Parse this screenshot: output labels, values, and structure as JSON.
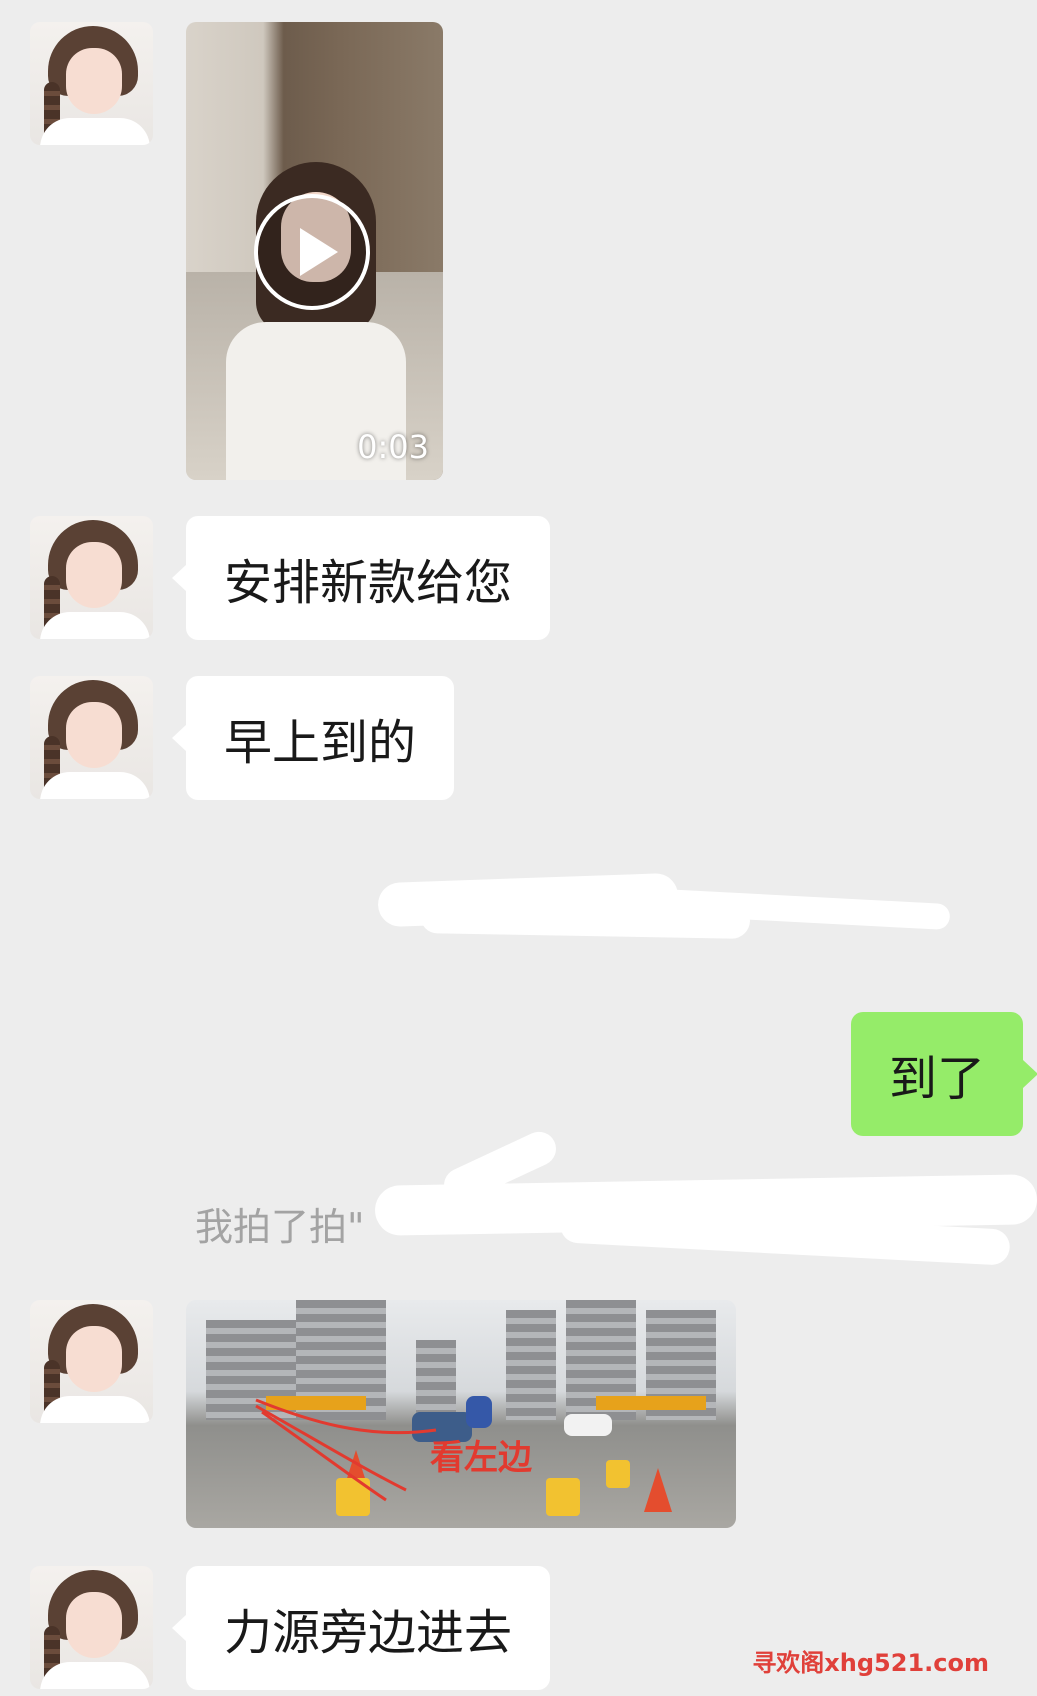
{
  "messages": {
    "video_duration": "0:03",
    "text_new_models": "安排新款给您",
    "text_arrived_morning": "早上到的",
    "text_sent_arrived": "到了",
    "system_pat": "我拍了拍\"",
    "photo_caption": "看左边",
    "text_enter_side": "力源旁边进去"
  },
  "watermark": "寻欢阁xhg521.com",
  "colors": {
    "background": "#ededed",
    "incoming_bubble": "#ffffff",
    "outgoing_bubble": "#95ec69",
    "system_text": "#a3a3a3",
    "watermark": "#e0403a"
  },
  "icons": {
    "play": "play-icon"
  }
}
